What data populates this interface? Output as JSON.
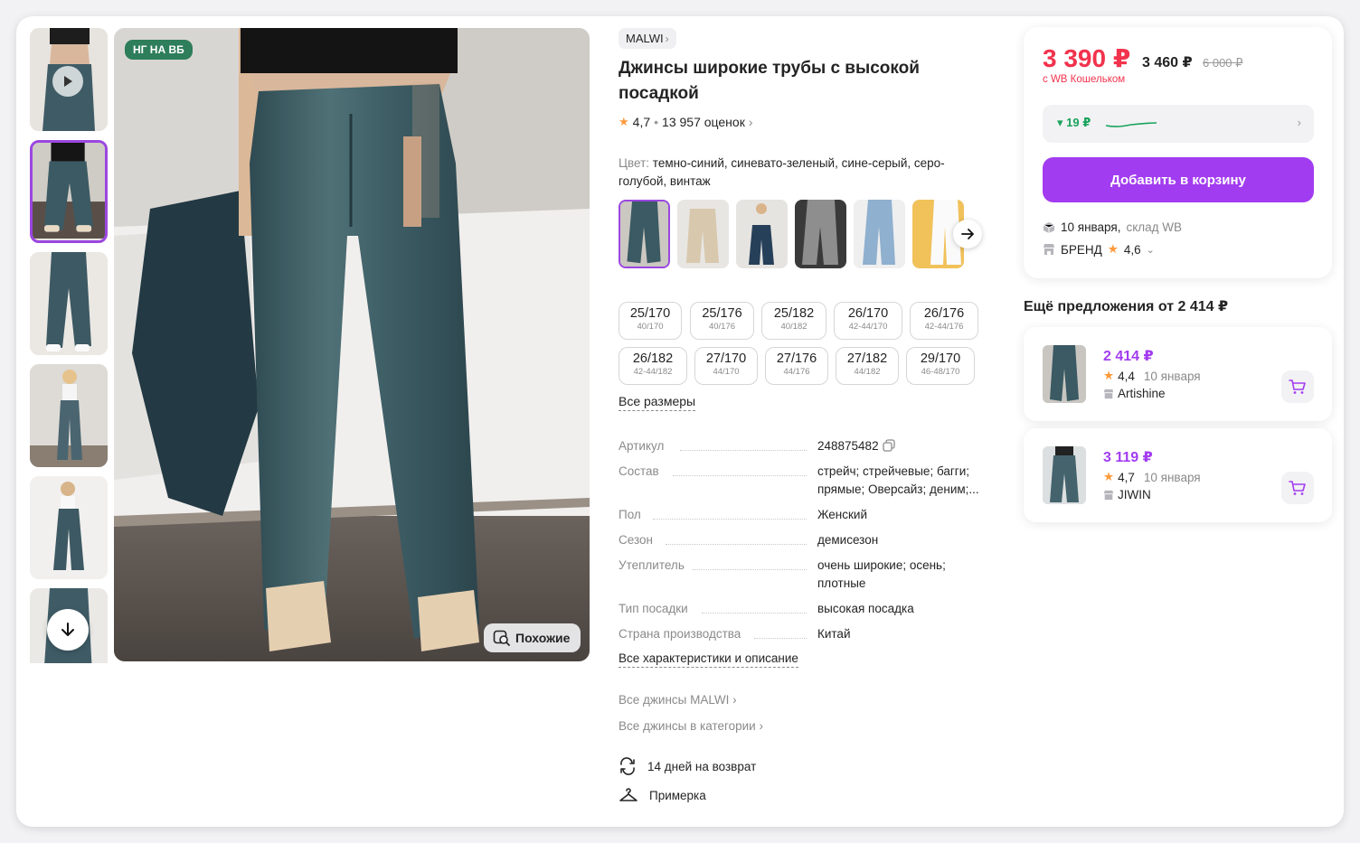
{
  "gallery": {
    "badge": "НГ НА ВБ",
    "similar_label": "Похожие",
    "thumbnails": [
      {
        "name": "thumb-video",
        "has_play": true
      },
      {
        "name": "thumb-2",
        "active": true
      },
      {
        "name": "thumb-3"
      },
      {
        "name": "thumb-4"
      },
      {
        "name": "thumb-5"
      },
      {
        "name": "thumb-6"
      }
    ]
  },
  "product": {
    "brand": "MALWI",
    "title": "Джинсы широкие трубы с высокой посадкой",
    "rating": "4,7",
    "reviews": "13 957 оценок",
    "color_label": "Цвет:",
    "color_value": "темно-синий, синевато-зеленый, сине-серый, серо-голубой, винтаж",
    "sizes": [
      {
        "size": "25/170",
        "ru": "40/170"
      },
      {
        "size": "25/176",
        "ru": "40/176"
      },
      {
        "size": "25/182",
        "ru": "40/182"
      },
      {
        "size": "26/170",
        "ru": "42-44/170"
      },
      {
        "size": "26/176",
        "ru": "42-44/176"
      },
      {
        "size": "26/182",
        "ru": "42-44/182"
      },
      {
        "size": "27/170",
        "ru": "44/170"
      },
      {
        "size": "27/176",
        "ru": "44/176"
      },
      {
        "size": "27/182",
        "ru": "44/182"
      },
      {
        "size": "29/170",
        "ru": "46-48/170"
      }
    ],
    "all_sizes": "Все размеры",
    "params": [
      {
        "key": "Артикул",
        "value": "248875482"
      },
      {
        "key": "Состав",
        "value": "стрейч; стрейчевые; багги; прямые; Оверсайз; деним;..."
      },
      {
        "key": "Пол",
        "value": "Женский"
      },
      {
        "key": "Сезон",
        "value": "демисезон"
      },
      {
        "key": "Утеплитель",
        "value": "очень широкие; осень; плотные"
      },
      {
        "key": "Тип посадки",
        "value": "высокая посадка"
      },
      {
        "key": "Страна производства",
        "value": "Китай"
      }
    ],
    "all_chars": "Все характеристики и описание",
    "link_brand": "Все джинсы MALWI",
    "link_category": "Все джинсы в категории",
    "return_label": "14 дней на возврат",
    "fitting_label": "Примерка"
  },
  "buy": {
    "price": "3 390 ₽",
    "price_no_wallet": "3 460 ₽",
    "price_old": "6 000 ₽",
    "wallet_note": "с WB Кошельком",
    "trend": "19 ₽",
    "add_to_cart": "Добавить в корзину",
    "delivery_date": "10 января,",
    "delivery_place": "склад WB",
    "store_name": "БРЕНД",
    "store_rating": "4,6"
  },
  "more_offers": {
    "title": "Ещё предложения от 2 414 ₽",
    "items": [
      {
        "price": "2 414 ₽",
        "rating": "4,4",
        "date": "10 января",
        "seller": "Artishine"
      },
      {
        "price": "3 119 ₽",
        "rating": "4,7",
        "date": "10 января",
        "seller": "JIWIN"
      }
    ]
  },
  "colors": {
    "accent": "#a23cf0",
    "price_red": "#f2334d",
    "green": "#1aa35c",
    "star": "#ff9a3c"
  }
}
